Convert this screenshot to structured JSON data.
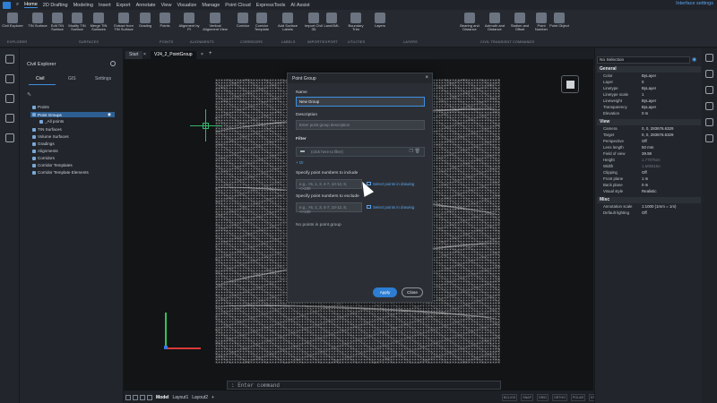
{
  "menubar": {
    "items": [
      "Home",
      "2D Drafting",
      "Modeling",
      "Insert",
      "Export",
      "Annotate",
      "View",
      "Visualize",
      "Manage",
      "Point Cloud",
      "ExpressTools",
      "AI Assist"
    ],
    "active": "Home",
    "interface_settings": "Interface settings"
  },
  "ribbon": {
    "buttons": [
      {
        "label": "Civil Explorer",
        "icon": "civil-explorer-icon"
      },
      {
        "label": "TIN Surface",
        "icon": "tin-surface-icon"
      },
      {
        "label": "Edit TIN Surface",
        "icon": "edit-tin-icon"
      },
      {
        "label": "Modify TIN Surface",
        "icon": "modify-tin-icon"
      },
      {
        "label": "Merge TIN Surfaces",
        "icon": "merge-tin-icon"
      },
      {
        "label": "Extract from TIN Surface",
        "icon": "extract-tin-icon"
      },
      {
        "label": "Grading",
        "icon": "grading-icon"
      },
      {
        "label": "Points",
        "icon": "points-icon"
      },
      {
        "label": "Alignment by PI",
        "icon": "alignment-icon"
      },
      {
        "label": "Vertical Alignment View",
        "icon": "vertical-alignment-icon"
      },
      {
        "label": "Corridor",
        "icon": "corridor-icon"
      },
      {
        "label": "Corridor Template",
        "icon": "corridor-template-icon"
      },
      {
        "label": "Add Surface Labels",
        "icon": "surface-labels-icon"
      },
      {
        "label": "Import Civil 3D",
        "icon": "import-civil3d-icon"
      },
      {
        "label": "LandXML",
        "icon": "landxml-icon"
      },
      {
        "label": "Boundary Trim",
        "icon": "boundary-trim-icon"
      },
      {
        "label": "Layers",
        "icon": "layers-icon"
      },
      {
        "label": "Bearing and Distance",
        "icon": "bearing-icon"
      },
      {
        "label": "Azimuth and Distance",
        "icon": "azimuth-icon"
      },
      {
        "label": "Station and Offset",
        "icon": "station-offset-icon"
      },
      {
        "label": "Point Number",
        "icon": "point-number-icon"
      },
      {
        "label": "Point Object",
        "icon": "point-object-icon"
      }
    ],
    "groups": [
      "EXPLORER",
      "SURFACES",
      "POINTS",
      "ALIGNMENTS",
      "CORRIDORS",
      "LABELS",
      "IMPORT/EXPORT",
      "UTILITIES",
      "LAYERS",
      "CIVIL TRANSIENT COMMANDS"
    ]
  },
  "explorer": {
    "title": "Civil Explorer",
    "tabs": [
      "Civil",
      "GIS",
      "Settings"
    ],
    "tree": [
      "Points",
      "Point Groups",
      "_All points",
      "TIN Surfaces",
      "Volume Surfaces",
      "Gradings",
      "Alignments",
      "Corridors",
      "Corridor Templates",
      "Corridor Template Elements"
    ]
  },
  "doctabs": [
    "Start",
    "V24_2_PointGroup"
  ],
  "dialog": {
    "title": "Point Group",
    "name_label": "Name",
    "name_value": "New Group",
    "description_label": "Description",
    "description_placeholder": "Enter point group description",
    "filter_label": "Filter",
    "filter_placeholder": "(click here to filter)",
    "or_label": "+ Or",
    "include_label": "Specify point numbers to include",
    "include_placeholder": "e.g., >5, 1, 3, 4-7, 10-12, 8, <>100",
    "include_link": "Select points in drawing",
    "exclude_label": "Specify point numbers to exclude",
    "exclude_placeholder": "e.g., >5, 1, 3, 4-7, 10-12, 8, <>100",
    "exclude_link": "Select points in drawing",
    "status": "No points in point group",
    "apply": "Apply",
    "close": "Close"
  },
  "command": {
    "prompt": ": Enter command"
  },
  "bottom": {
    "tabs": [
      "Model",
      "Layout1",
      "Layout2"
    ]
  },
  "status_items": [
    "BCL/GS",
    "SNAP",
    "GRID",
    "ORTHO",
    "POLAR",
    "ESNAP",
    "STRACK",
    "LWT",
    "TILE",
    "1:1",
    "DUCS",
    "DYN",
    "QUAD",
    "RT",
    "HKA",
    "LOCKUI"
  ],
  "properties": {
    "selection": "No Selection",
    "sections": [
      {
        "name": "General",
        "rows": [
          [
            "Color",
            "ByLayer"
          ],
          [
            "Layer",
            "0"
          ],
          [
            "Linetype",
            "ByLayer"
          ],
          [
            "Linetype scale",
            "1"
          ],
          [
            "Lineweight",
            "ByLayer"
          ],
          [
            "Transparency",
            "ByLayer"
          ],
          [
            "Elevation",
            "0 m"
          ]
        ]
      },
      {
        "name": "View",
        "rows": [
          [
            "Camera",
            "0, 0, 283676.6329"
          ],
          [
            "Target",
            "0, 0, 283676.6329"
          ],
          [
            "Perspective",
            "Off"
          ],
          [
            "Lens length",
            "50 mm"
          ],
          [
            "Field of view",
            "39.98"
          ],
          [
            "Height",
            "1.778752e"
          ],
          [
            "Width",
            "1.605615e"
          ],
          [
            "Clipping",
            "Off"
          ],
          [
            "Front plane",
            "1 m"
          ],
          [
            "Back plane",
            "0 m"
          ],
          [
            "Visual style",
            "Realistic"
          ]
        ]
      },
      {
        "name": "Misc",
        "rows": [
          [
            "Annotation scale",
            "1:1000 (1mm = 1m)"
          ],
          [
            "Default lighting",
            "Off"
          ]
        ]
      }
    ]
  },
  "colors": {
    "accent": "#2d7dd2",
    "ucs_x": "#d93a3a",
    "ucs_y": "#2ec45a",
    "ucs_z": "#3b74e0"
  }
}
